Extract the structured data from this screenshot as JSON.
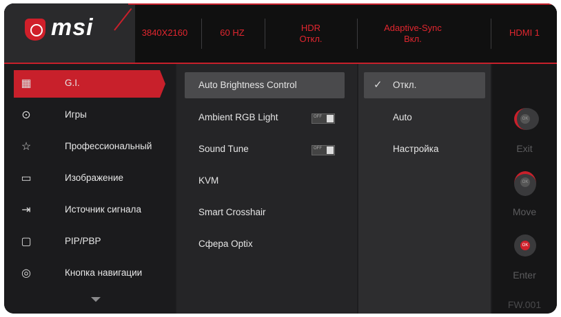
{
  "header": {
    "logo": "msi",
    "resolution": "3840X2160",
    "refresh": "60 HZ",
    "hdr_title": "HDR",
    "hdr_value": "Откл.",
    "sync_title": "Adaptive-Sync",
    "sync_value": "Вкл.",
    "input": "HDMI 1"
  },
  "colors": {
    "accent": "#c8202b",
    "panel": "#1d1d1f"
  },
  "menu": {
    "items": [
      {
        "label": "G.I.",
        "icon": "gi-icon"
      },
      {
        "label": "Игры",
        "icon": "gamepad-icon"
      },
      {
        "label": "Профессиональный",
        "icon": "star-icon"
      },
      {
        "label": "Изображение",
        "icon": "image-icon"
      },
      {
        "label": "Источник сигнала",
        "icon": "input-source-icon"
      },
      {
        "label": "PIP/PBP",
        "icon": "pip-icon"
      },
      {
        "label": "Кнопка навигации",
        "icon": "nav-key-icon"
      }
    ]
  },
  "submenu": {
    "items": [
      {
        "label": "Auto Brightness Control"
      },
      {
        "label": "Ambient RGB Light",
        "toggle": "OFF"
      },
      {
        "label": "Sound Tune",
        "toggle": "OFF"
      },
      {
        "label": "KVM"
      },
      {
        "label": "Smart Crosshair"
      },
      {
        "label": "Сфера Optix"
      }
    ]
  },
  "options": {
    "items": [
      {
        "label": "Откл."
      },
      {
        "label": "Auto"
      },
      {
        "label": "Настройка"
      }
    ]
  },
  "controls": {
    "exit": "Exit",
    "move": "Move",
    "enter": "Enter",
    "ok": "OK",
    "firmware": "FW.001"
  }
}
